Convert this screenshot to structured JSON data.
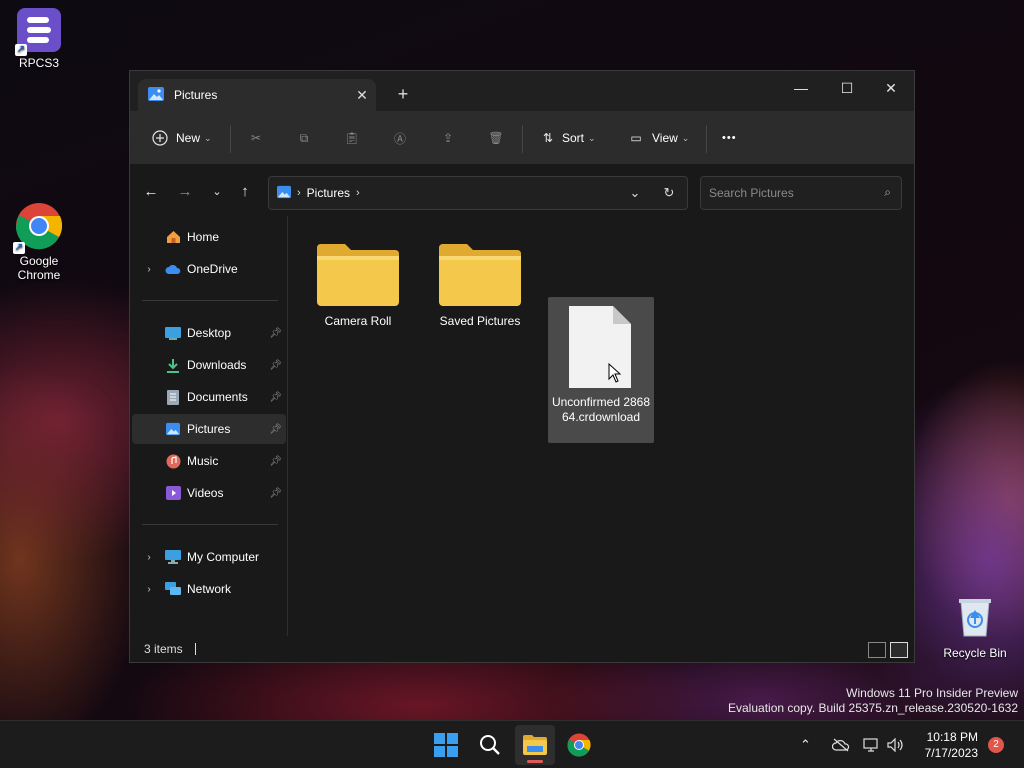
{
  "desktop": {
    "icons": [
      {
        "label": "RPCS3"
      },
      {
        "label": "Google Chrome"
      },
      {
        "label": "Recycle Bin"
      }
    ],
    "watermark": {
      "line1": "Windows 11 Pro Insider Preview",
      "line2": "Evaluation copy. Build 25375.zn_release.230520-1632"
    }
  },
  "window": {
    "tab_title": "Pictures",
    "new_tab_label": "+",
    "controls": {
      "minimize": "—",
      "maximize": "☐",
      "close": "✕"
    },
    "toolbar": {
      "new_label": "New",
      "sort_label": "Sort",
      "view_label": "View",
      "more_label": "•••"
    },
    "address": {
      "crumbs": [
        "Pictures"
      ]
    },
    "search": {
      "placeholder": "Search Pictures"
    },
    "sidebar": {
      "items": [
        {
          "label": "Home",
          "icon": "home-icon"
        },
        {
          "label": "OneDrive",
          "icon": "cloud-icon"
        },
        {
          "label": "Desktop",
          "icon": "desktop-icon"
        },
        {
          "label": "Downloads",
          "icon": "download-icon"
        },
        {
          "label": "Documents",
          "icon": "document-icon"
        },
        {
          "label": "Pictures",
          "icon": "pictures-icon"
        },
        {
          "label": "Music",
          "icon": "music-icon"
        },
        {
          "label": "Videos",
          "icon": "video-icon"
        },
        {
          "label": "My Computer",
          "icon": "computer-icon"
        },
        {
          "label": "Network",
          "icon": "network-icon"
        }
      ],
      "selected": "Pictures"
    },
    "files": [
      {
        "name": "Camera Roll",
        "type": "folder"
      },
      {
        "name": "Saved Pictures",
        "type": "folder"
      },
      {
        "name": "Unconfirmed 286864.crdownload",
        "type": "file",
        "selected": true
      }
    ],
    "status": {
      "count": "3 items"
    }
  },
  "taskbar": {
    "clock": {
      "time": "10:18 PM",
      "date": "7/17/2023"
    },
    "notifications": "2"
  },
  "colors": {
    "folder": "#f4c84a",
    "accent": "#3b8ef0",
    "notification": "#e0564a"
  }
}
